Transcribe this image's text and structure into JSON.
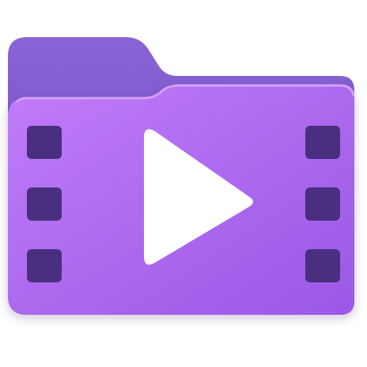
{
  "icon": {
    "name": "video-folder-icon",
    "colors": {
      "background": "#ffffff",
      "folder_back_top": "#8a64d6",
      "folder_back_bottom": "#6a46b6",
      "folder_front_top": "#c07cf8",
      "folder_front_bottom": "#9a58e6",
      "front_highlight": "#d9a6ff",
      "sprocket_hole": "#4a2f80",
      "play_triangle": "#ffffff"
    },
    "parts": {
      "sprocket_holes_per_side": 3,
      "play_glyph": "play-triangle-icon"
    }
  }
}
